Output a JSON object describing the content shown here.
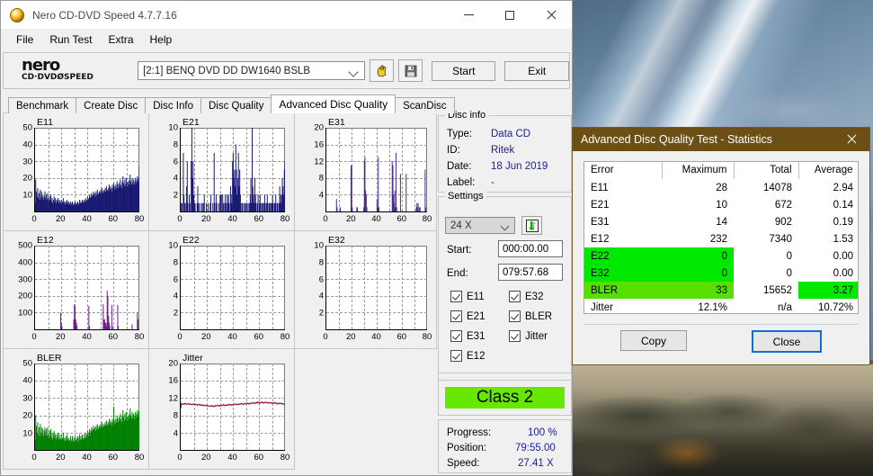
{
  "window": {
    "title": "Nero CD-DVD Speed 4.7.7.16",
    "icon": "nero-icon",
    "minimize": "—",
    "maximize": "□",
    "close": "✕"
  },
  "menu": {
    "items": [
      "File",
      "Run Test",
      "Extra",
      "Help"
    ]
  },
  "toolbar": {
    "logo_line1": "nero",
    "logo_line2": "CD·DVDØSPEED",
    "drive": "[2:1]   BENQ DVD DD DW1640 BSLB",
    "eject_icon": "eject-hand-icon",
    "save_icon": "floppy-save-icon",
    "start_label": "Start",
    "exit_label": "Exit"
  },
  "tabs": {
    "items": [
      "Benchmark",
      "Create Disc",
      "Disc Info",
      "Disc Quality",
      "Advanced Disc Quality",
      "ScanDisc"
    ],
    "active": "Advanced Disc Quality"
  },
  "disc_info": {
    "legend": "Disc info",
    "rows": [
      {
        "key": "Type:",
        "value": "Data CD"
      },
      {
        "key": "ID:",
        "value": "Ritek"
      },
      {
        "key": "Date:",
        "value": "18 Jun 2019"
      },
      {
        "key": "Label:",
        "value": "-"
      }
    ]
  },
  "settings": {
    "legend": "Settings",
    "speed": "24 X",
    "refresh_icon": "refresh-speed-icon",
    "start_label": "Start:",
    "start_value": "000:00.00",
    "end_label": "End:",
    "end_value": "079:57.68",
    "checkboxes": [
      {
        "label": "E11",
        "checked": true
      },
      {
        "label": "E32",
        "checked": true
      },
      {
        "label": "E21",
        "checked": true
      },
      {
        "label": "BLER",
        "checked": true
      },
      {
        "label": "E31",
        "checked": true
      },
      {
        "label": "Jitter",
        "checked": true
      },
      {
        "label": "E12",
        "checked": true
      },
      {
        "label": "E22",
        "checked": true
      }
    ]
  },
  "quality_class": {
    "label": "Class 2",
    "color": "#66e800"
  },
  "progress_panel": {
    "rows": [
      {
        "key": "Progress:",
        "value": "100 %"
      },
      {
        "key": "Position:",
        "value": "79:55.00"
      },
      {
        "key": "Speed:",
        "value": "27.41 X"
      }
    ]
  },
  "stats_dialog": {
    "title": "Advanced Disc Quality Test - Statistics",
    "close_icon": "close-icon",
    "columns": [
      "Error",
      "Maximum",
      "Total",
      "Average"
    ],
    "rows": [
      {
        "cells": [
          "E11",
          "28",
          "14078",
          "2.94"
        ],
        "highlight": "none"
      },
      {
        "cells": [
          "E21",
          "10",
          "672",
          "0.14"
        ],
        "highlight": "none"
      },
      {
        "cells": [
          "E31",
          "14",
          "902",
          "0.19"
        ],
        "highlight": "none"
      },
      {
        "cells": [
          "E12",
          "232",
          "7340",
          "1.53"
        ],
        "highlight": "none"
      },
      {
        "cells": [
          "E22",
          "0",
          "0",
          "0.00"
        ],
        "highlight": "left-bright"
      },
      {
        "cells": [
          "E32",
          "0",
          "0",
          "0.00"
        ],
        "highlight": "left-bright"
      },
      {
        "cells": [
          "BLER",
          "33",
          "15652",
          "3.27"
        ],
        "highlight": "bler"
      },
      {
        "cells": [
          "Jitter",
          "12.1%",
          "n/a",
          "10.72%"
        ],
        "highlight": "none"
      }
    ],
    "copy_label": "Copy",
    "close_label": "Close"
  },
  "chart_data": [
    {
      "id": "e11",
      "type": "area",
      "title": "E11",
      "color": "#191970",
      "xlabel": "",
      "ylabel": "",
      "xlim": [
        0,
        80
      ],
      "ylim": [
        0,
        50
      ],
      "xticks": [
        0,
        20,
        40,
        60,
        80
      ],
      "yticks": [
        10,
        20,
        30,
        40,
        50
      ],
      "grid": true,
      "values": [
        5,
        19,
        12,
        9,
        14,
        8,
        11,
        7,
        13,
        9,
        12,
        8,
        10,
        7,
        9,
        12,
        8,
        10,
        7,
        11,
        8,
        6,
        9,
        7,
        10,
        6,
        8,
        5,
        7,
        9,
        6,
        8,
        5,
        7,
        6,
        8,
        5,
        7,
        6,
        5,
        7,
        5,
        6,
        8,
        5,
        6,
        4,
        6,
        5,
        7,
        5,
        6,
        4,
        5,
        6,
        4,
        5,
        6,
        4,
        5,
        4,
        6,
        5,
        4,
        5,
        6,
        4,
        5,
        7,
        5,
        6,
        5,
        7,
        6,
        5,
        7,
        6,
        8,
        6,
        7,
        9,
        7,
        8,
        10,
        8,
        9,
        11,
        9,
        10,
        12,
        10,
        11,
        9,
        12,
        10,
        13,
        11,
        10,
        12,
        11,
        13,
        11,
        14,
        12,
        11,
        13,
        12,
        14,
        12,
        15,
        13,
        12,
        14,
        16,
        13,
        15,
        14,
        12,
        16,
        14,
        17,
        15,
        13,
        16,
        14,
        18,
        16,
        14,
        17,
        15,
        19,
        16,
        14,
        18,
        21,
        17,
        15,
        19,
        16,
        20,
        17,
        15,
        18,
        16,
        19,
        22,
        18,
        16,
        20,
        17,
        19,
        16,
        18,
        20,
        17,
        19,
        21,
        18,
        20,
        27
      ]
    },
    {
      "id": "e21",
      "type": "area",
      "title": "E21",
      "color": "#191970",
      "xlim": [
        0,
        80
      ],
      "ylim": [
        0,
        10
      ],
      "xticks": [
        0,
        20,
        40,
        60,
        80
      ],
      "yticks": [
        2,
        4,
        6,
        8,
        10
      ],
      "grid": true,
      "values": [
        0,
        1,
        1,
        0,
        7,
        2,
        1,
        0,
        1,
        3,
        6,
        1,
        0,
        2,
        1,
        0,
        6,
        10,
        4,
        6,
        2,
        1,
        1,
        0,
        0,
        1,
        3,
        1,
        0,
        1,
        0,
        0,
        1,
        1,
        0,
        1,
        2,
        0,
        0,
        1,
        0,
        0,
        1,
        0,
        0,
        1,
        2,
        0,
        0,
        1,
        0,
        7,
        1,
        0,
        2,
        1,
        0,
        0,
        1,
        0,
        2,
        2,
        2,
        0,
        2,
        1,
        0,
        1,
        2,
        1,
        0,
        2,
        1,
        2,
        1,
        0,
        3,
        2,
        1,
        6,
        7,
        4,
        5,
        3,
        8,
        5,
        2,
        4,
        7,
        3,
        5,
        2,
        1,
        0,
        1,
        0,
        1,
        0,
        1,
        0,
        1,
        1,
        0,
        1,
        0,
        1,
        2,
        4,
        1,
        10,
        3,
        2,
        1,
        4,
        2,
        1,
        0,
        1,
        2,
        0,
        1,
        2,
        1,
        0,
        1,
        1,
        0,
        1,
        2,
        1,
        0,
        1,
        2,
        1,
        0,
        1,
        1,
        0,
        1,
        1,
        2,
        1,
        0,
        1,
        1,
        2,
        0,
        1,
        1,
        0,
        1,
        3,
        2,
        1,
        2,
        4,
        3,
        2,
        5,
        6
      ]
    },
    {
      "id": "e31",
      "type": "area",
      "title": "E31",
      "color": "#4b2a8a",
      "xlim": [
        0,
        80
      ],
      "ylim": [
        0,
        20
      ],
      "xticks": [
        0,
        20,
        40,
        60,
        80
      ],
      "yticks": [
        4,
        8,
        12,
        16,
        20
      ],
      "grid": true,
      "values": [
        0,
        0,
        0,
        0,
        0,
        0,
        0,
        0,
        0,
        0,
        0,
        0,
        0,
        0,
        0,
        0,
        3,
        1,
        0,
        0,
        0,
        0,
        1,
        0,
        0,
        0,
        0,
        0,
        0,
        0,
        0,
        0,
        0,
        0,
        0,
        0,
        0,
        0,
        0,
        11,
        11,
        1,
        0,
        0,
        0,
        0,
        0,
        0,
        1,
        1,
        0,
        0,
        0,
        0,
        0,
        0,
        0,
        0,
        0,
        1,
        12,
        13,
        5,
        4,
        1,
        0,
        0,
        0,
        0,
        0,
        0,
        0,
        0,
        0,
        0,
        0,
        0,
        0,
        0,
        0,
        3,
        1,
        13,
        1,
        0,
        0,
        0,
        0,
        0,
        0,
        0,
        0,
        0,
        0,
        0,
        0,
        0,
        0,
        0,
        0,
        0,
        0,
        0,
        0,
        12,
        11,
        4,
        2,
        5,
        1,
        14,
        1,
        0,
        0,
        0,
        0,
        0,
        9,
        0,
        0,
        0,
        0,
        0,
        0,
        0,
        0,
        9,
        0,
        0,
        0,
        0,
        0,
        0,
        0,
        0,
        0,
        0,
        0,
        0,
        0,
        0,
        0,
        1,
        2,
        1,
        2,
        0,
        1,
        1,
        0,
        0,
        0,
        0,
        0,
        0,
        0,
        10,
        1,
        0,
        0
      ]
    },
    {
      "id": "e12",
      "type": "area",
      "title": "E12",
      "color": "#6a1f8e",
      "xlim": [
        0,
        80
      ],
      "ylim": [
        0,
        500
      ],
      "xticks": [
        0,
        20,
        40,
        60,
        80
      ],
      "yticks": [
        100,
        200,
        300,
        400,
        500
      ],
      "grid": true,
      "values": [
        0,
        0,
        0,
        0,
        0,
        0,
        0,
        0,
        0,
        0,
        0,
        0,
        0,
        0,
        0,
        0,
        0,
        0,
        0,
        0,
        0,
        0,
        0,
        0,
        0,
        0,
        0,
        0,
        0,
        0,
        0,
        0,
        0,
        0,
        0,
        0,
        0,
        0,
        0,
        100,
        40,
        20,
        0,
        0,
        0,
        0,
        0,
        0,
        0,
        0,
        0,
        0,
        0,
        0,
        0,
        0,
        0,
        0,
        0,
        60,
        150,
        140,
        60,
        40,
        20,
        0,
        0,
        0,
        0,
        0,
        0,
        0,
        0,
        0,
        0,
        0,
        0,
        0,
        0,
        0,
        0,
        0,
        140,
        20,
        0,
        0,
        0,
        0,
        0,
        0,
        0,
        0,
        0,
        0,
        0,
        0,
        0,
        0,
        0,
        0,
        0,
        0,
        0,
        0,
        150,
        60,
        60,
        40,
        40,
        20,
        232,
        200,
        80,
        40,
        20,
        0,
        0,
        145,
        20,
        0,
        0,
        0,
        0,
        0,
        0,
        0,
        145,
        20,
        0,
        0,
        0,
        0,
        0,
        0,
        0,
        0,
        0,
        0,
        0,
        0,
        0,
        0,
        0,
        0,
        0,
        0,
        0,
        0,
        30,
        0,
        0,
        0,
        0,
        0,
        0,
        0,
        100,
        60,
        0,
        0
      ]
    },
    {
      "id": "e22",
      "type": "area",
      "title": "E22",
      "color": "#191970",
      "xlim": [
        0,
        80
      ],
      "ylim": [
        0,
        10
      ],
      "xticks": [
        0,
        20,
        40,
        60,
        80
      ],
      "yticks": [
        2,
        4,
        6,
        8,
        10
      ],
      "grid": true,
      "values": []
    },
    {
      "id": "e32",
      "type": "area",
      "title": "E32",
      "color": "#191970",
      "xlim": [
        0,
        80
      ],
      "ylim": [
        0,
        10
      ],
      "xticks": [
        0,
        20,
        40,
        60,
        80
      ],
      "yticks": [
        2,
        4,
        6,
        8,
        10
      ],
      "grid": true,
      "values": []
    },
    {
      "id": "bler",
      "type": "area",
      "title": "BLER",
      "color": "#008000",
      "xlim": [
        0,
        80
      ],
      "ylim": [
        0,
        50
      ],
      "xticks": [
        0,
        20,
        40,
        60,
        80
      ],
      "yticks": [
        10,
        20,
        30,
        40,
        50
      ],
      "grid": true,
      "values": [
        6,
        20,
        14,
        10,
        16,
        9,
        13,
        8,
        15,
        10,
        13,
        9,
        12,
        8,
        11,
        13,
        9,
        12,
        8,
        13,
        9,
        7,
        11,
        8,
        12,
        7,
        10,
        6,
        9,
        11,
        7,
        9,
        6,
        9,
        7,
        10,
        6,
        9,
        7,
        6,
        9,
        6,
        7,
        10,
        6,
        7,
        5,
        8,
        6,
        9,
        6,
        7,
        5,
        6,
        8,
        5,
        6,
        8,
        5,
        7,
        5,
        8,
        6,
        5,
        7,
        8,
        5,
        7,
        9,
        6,
        8,
        6,
        9,
        7,
        6,
        9,
        7,
        10,
        7,
        9,
        11,
        8,
        10,
        12,
        9,
        11,
        13,
        11,
        12,
        14,
        12,
        13,
        11,
        14,
        12,
        15,
        13,
        12,
        14,
        13,
        15,
        13,
        16,
        14,
        13,
        15,
        14,
        16,
        14,
        17,
        15,
        14,
        16,
        18,
        15,
        17,
        16,
        14,
        18,
        16,
        25,
        17,
        15,
        18,
        16,
        20,
        18,
        16,
        19,
        17,
        21,
        18,
        16,
        20,
        23,
        19,
        17,
        21,
        18,
        22,
        19,
        17,
        20,
        18,
        21,
        24,
        20,
        18,
        22,
        19,
        21,
        18,
        20,
        22,
        19,
        21,
        23,
        20,
        22,
        23
      ]
    },
    {
      "id": "jitter",
      "type": "line",
      "title": "Jitter",
      "color": "#8b1a4a",
      "xlim": [
        0,
        80
      ],
      "ylim": [
        0,
        20
      ],
      "xticks": [
        0,
        20,
        40,
        60,
        80
      ],
      "yticks": [
        4,
        8,
        12,
        16,
        20
      ],
      "grid": true,
      "values": [
        9.6,
        10.8,
        10.5,
        10.6,
        10.7,
        10.5,
        10.8,
        10.6,
        10.7,
        10.5,
        10.6,
        10.8,
        10.6,
        10.5,
        10.7,
        10.5,
        10.6,
        10.4,
        10.6,
        10.5,
        10.7,
        10.5,
        10.4,
        10.6,
        10.5,
        10.3,
        10.5,
        10.4,
        10.6,
        10.4,
        10.3,
        10.5,
        10.3,
        10.4,
        10.2,
        10.4,
        10.3,
        10.2,
        10.4,
        10.2,
        10.1,
        10.3,
        10.2,
        10.1,
        10.2,
        10.1,
        10.3,
        10.1,
        10.2,
        10.0,
        10.2,
        10.1,
        10.3,
        10.1,
        10.2,
        10.4,
        10.2,
        10.3,
        10.1,
        10.3,
        10.2,
        10.4,
        10.2,
        10.3,
        10.5,
        10.3,
        10.4,
        10.2,
        10.4,
        10.3,
        10.5,
        10.3,
        10.4,
        10.6,
        10.4,
        10.5,
        10.3,
        10.5,
        10.4,
        10.6,
        10.4,
        10.5,
        10.7,
        10.5,
        10.6,
        10.4,
        10.6,
        10.5,
        10.7,
        10.5,
        10.6,
        10.8,
        10.6,
        10.7,
        10.5,
        10.7,
        10.6,
        10.8,
        10.6,
        10.7,
        10.9,
        10.7,
        10.8,
        10.6,
        10.8,
        10.7,
        10.9,
        10.7,
        10.8,
        11.0,
        10.8,
        10.9,
        10.7,
        10.9,
        11.0,
        10.8,
        11.1,
        10.9,
        11.0,
        10.8,
        11.0,
        10.9,
        11.1,
        10.9,
        11.0,
        10.8,
        11.0,
        10.9,
        11.1,
        10.9,
        11.0,
        10.8,
        11.0,
        10.9,
        10.8,
        11.0,
        10.9,
        10.7,
        10.9,
        10.8,
        11.0,
        10.8,
        10.9,
        10.7,
        10.9,
        10.8,
        10.6,
        10.8,
        10.7,
        10.9,
        10.7,
        10.8,
        10.6,
        10.8,
        10.7,
        10.5,
        10.7,
        10.6
      ]
    }
  ]
}
